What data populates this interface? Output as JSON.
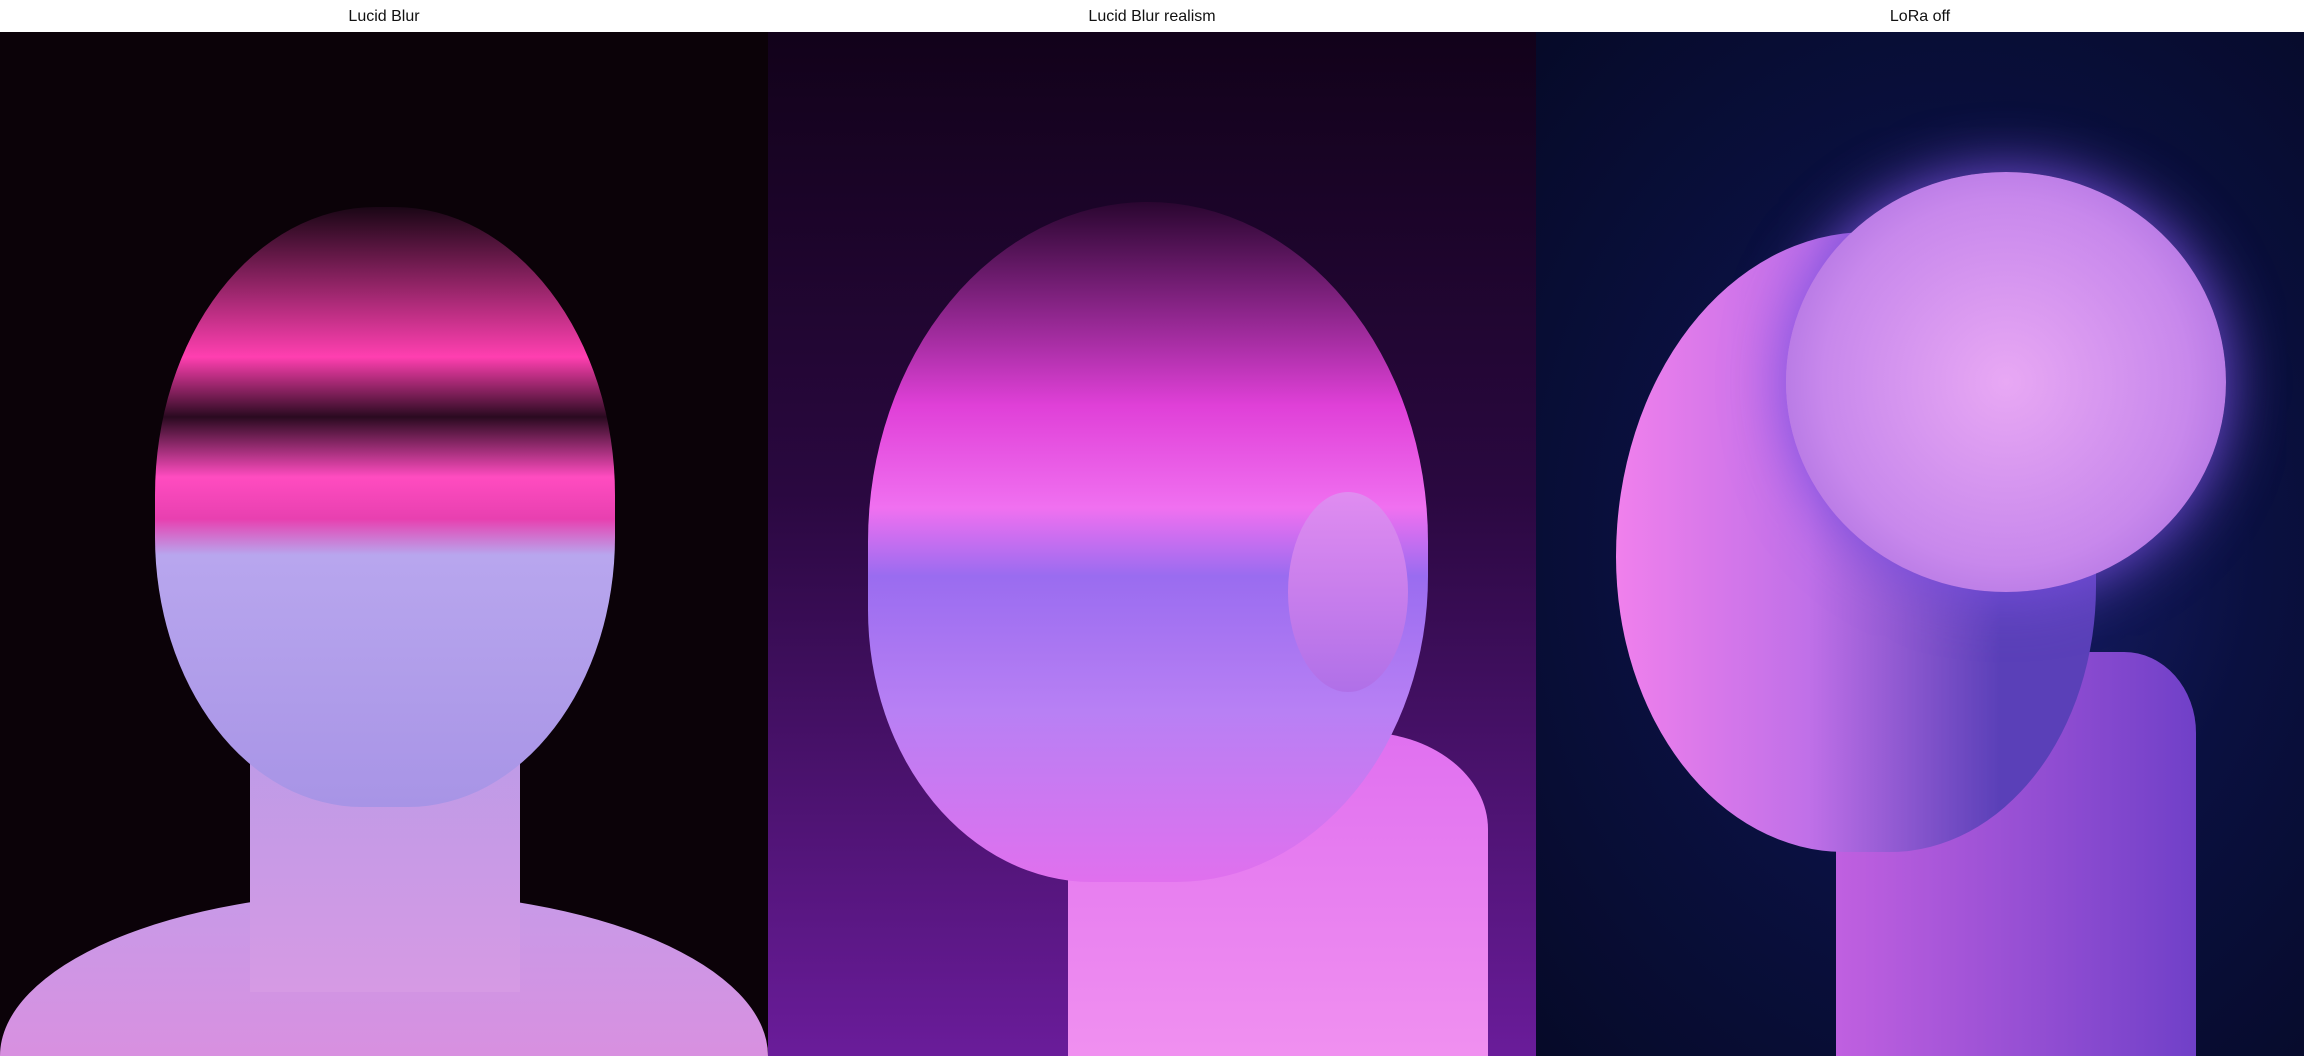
{
  "columns": [
    {
      "label": "Lucid Blur"
    },
    {
      "label": "Lucid Blur realism"
    },
    {
      "label": "LoRa off"
    }
  ]
}
